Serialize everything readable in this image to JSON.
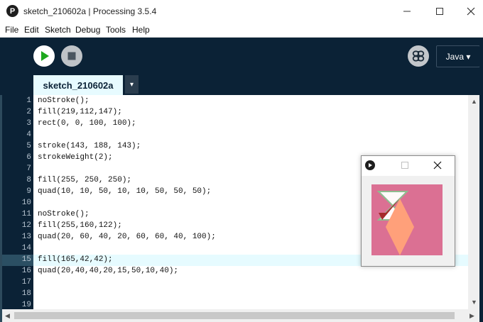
{
  "window": {
    "title": "sketch_210602a | Processing 3.5.4",
    "app_icon_glyph": "P"
  },
  "menubar": [
    "File",
    "Edit",
    "Sketch",
    "Debug",
    "Tools",
    "Help"
  ],
  "toolbar": {
    "mode_label": "Java ▾"
  },
  "tabs": {
    "active": "sketch_210602a",
    "menu_glyph": "▾"
  },
  "editor": {
    "current_line": 15,
    "lines": [
      {
        "num": "1",
        "text": "noStroke();"
      },
      {
        "num": "2",
        "text": "fill(219,112,147);"
      },
      {
        "num": "3",
        "text": "rect(0, 0, 100, 100);"
      },
      {
        "num": "4",
        "text": ""
      },
      {
        "num": "5",
        "text": "stroke(143, 188, 143);"
      },
      {
        "num": "6",
        "text": "strokeWeight(2);"
      },
      {
        "num": "7",
        "text": ""
      },
      {
        "num": "8",
        "text": "fill(255, 250, 250);"
      },
      {
        "num": "9",
        "text": "quad(10, 10, 50, 10, 10, 50, 50, 50);"
      },
      {
        "num": "10",
        "text": ""
      },
      {
        "num": "11",
        "text": "noStroke();"
      },
      {
        "num": "12",
        "text": "fill(255,160,122);"
      },
      {
        "num": "13",
        "text": "quad(20, 60, 40, 20, 60, 60, 40, 100);"
      },
      {
        "num": "14",
        "text": ""
      },
      {
        "num": "15",
        "text": "fill(165,42,42);"
      },
      {
        "num": "16",
        "text": "quad(20,40,40,20,15,50,10,40);"
      },
      {
        "num": "17",
        "text": ""
      },
      {
        "num": "18",
        "text": ""
      },
      {
        "num": "19",
        "text": ""
      }
    ]
  },
  "sketch_window": {
    "canvas_bg": "#db7093",
    "shapes_colors": {
      "quad1_fill": "#fffafa",
      "quad1_stroke": "#8fbc8f",
      "quad2_fill": "#ffa07a",
      "quad3_fill": "#a52a2a"
    }
  },
  "colors": {
    "toolbar_bg": "#0b2236",
    "run_icon": "#1ea81e",
    "highlight_line": "#e6fbff"
  }
}
